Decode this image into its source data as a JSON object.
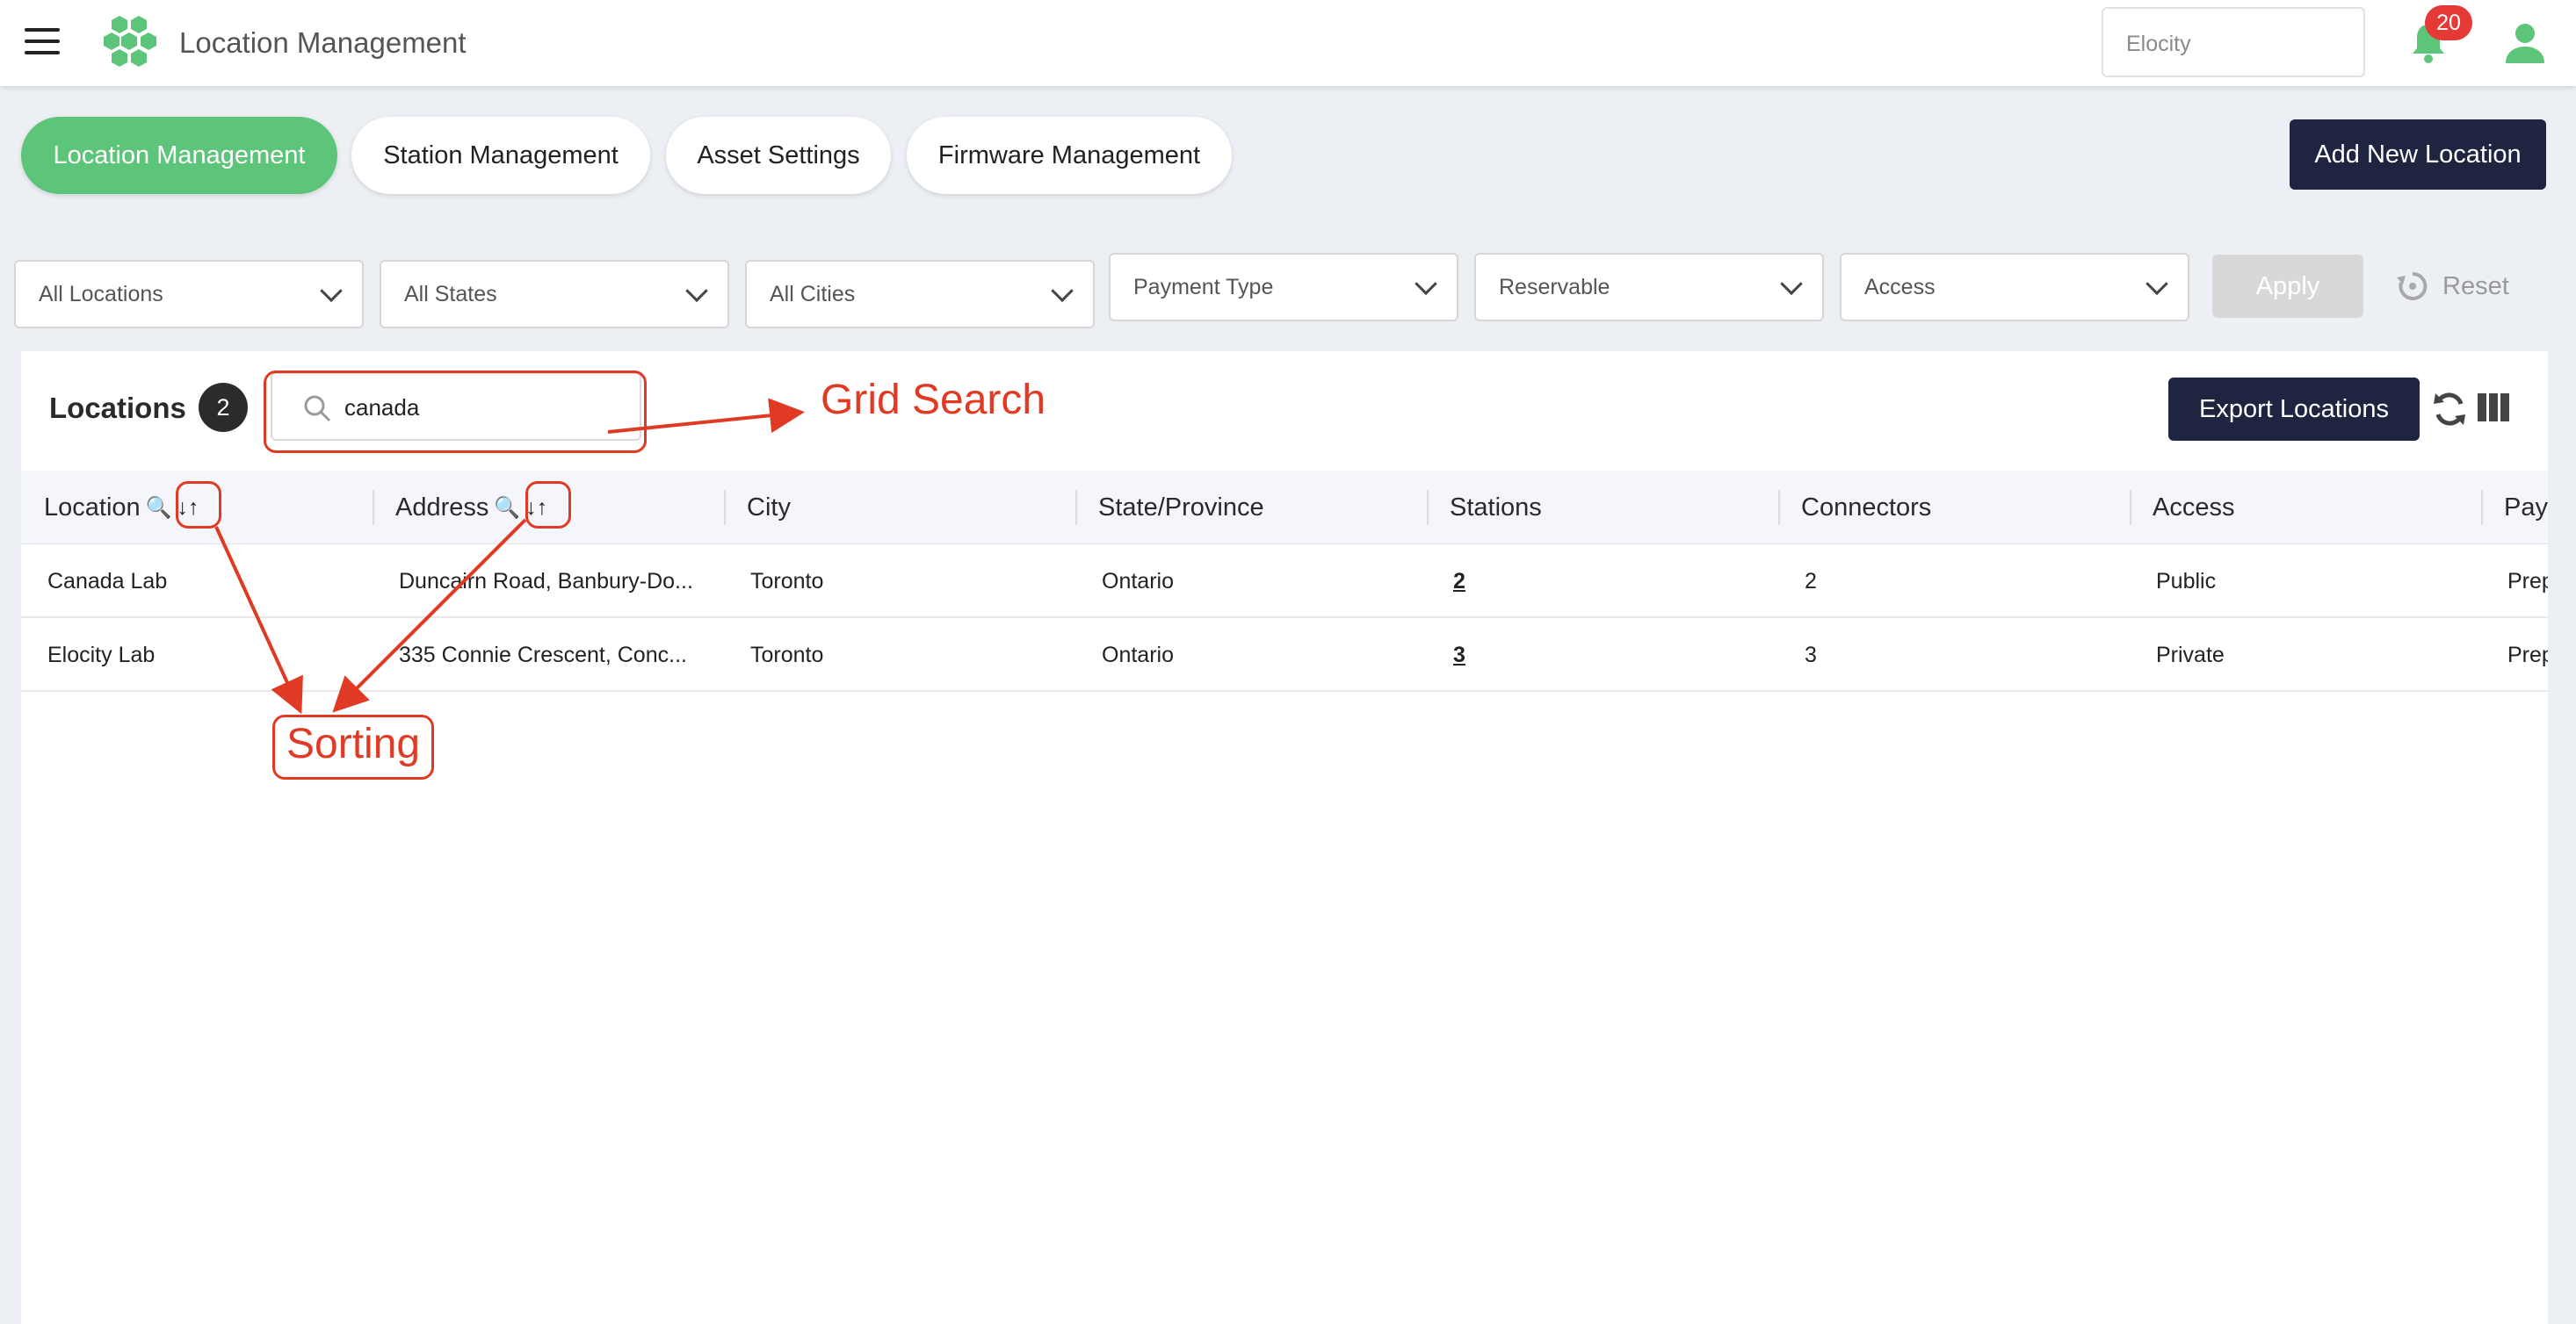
{
  "header": {
    "title": "Location Management",
    "org_select_value": "Elocity",
    "notification_count": "20"
  },
  "tabs": [
    {
      "label": "Location Management",
      "active": true
    },
    {
      "label": "Station Management",
      "active": false
    },
    {
      "label": "Asset Settings",
      "active": false
    },
    {
      "label": "Firmware Management",
      "active": false
    }
  ],
  "add_button_label": "Add New Location",
  "filters": {
    "locations": "All Locations",
    "states": "All States",
    "cities": "All Cities",
    "payment_type": "Payment Type",
    "reservable": "Reservable",
    "access": "Access",
    "apply_label": "Apply",
    "reset_label": "Reset"
  },
  "grid": {
    "title": "Locations",
    "count": "2",
    "search_value": "canada",
    "export_label": "Export Locations",
    "columns": [
      "Location",
      "Address",
      "City",
      "State/Province",
      "Stations",
      "Connectors",
      "Access",
      "Pay"
    ],
    "rows": [
      {
        "location": "Canada Lab",
        "address": "Duncairn Road, Banbury-Do...",
        "city": "Toronto",
        "state": "Ontario",
        "stations": "2",
        "connectors": "2",
        "access": "Public",
        "payment": "Prep"
      },
      {
        "location": "Elocity Lab",
        "address": "335 Connie Crescent, Conc...",
        "city": "Toronto",
        "state": "Ontario",
        "stations": "3",
        "connectors": "3",
        "access": "Private",
        "payment": "Prep"
      }
    ]
  },
  "annotations": {
    "grid_search": "Grid Search",
    "sorting": "Sorting",
    "color": "#e03a24"
  },
  "colors": {
    "accent_green": "#5cc57a",
    "navy_button": "#1f2440",
    "badge_red": "#e53935"
  },
  "icons": [
    "menu-icon",
    "logo-hexagons-icon",
    "bell-icon",
    "user-icon",
    "search-icon",
    "refresh-icon",
    "columns-icon",
    "sort-icon",
    "reset-icon",
    "chevron-down-icon"
  ]
}
